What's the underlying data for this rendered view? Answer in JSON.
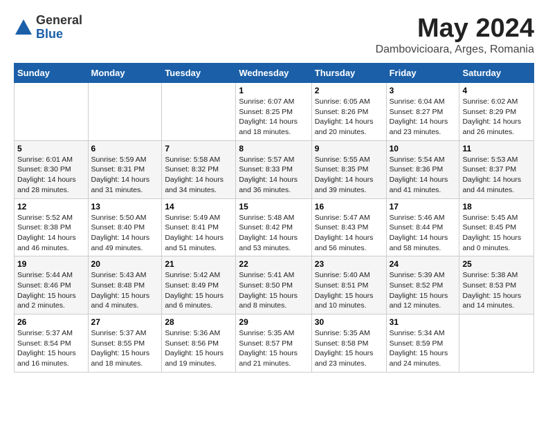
{
  "header": {
    "logo_general": "General",
    "logo_blue": "Blue",
    "month_title": "May 2024",
    "location": "Dambovicioara, Arges, Romania"
  },
  "calendar": {
    "days_of_week": [
      "Sunday",
      "Monday",
      "Tuesday",
      "Wednesday",
      "Thursday",
      "Friday",
      "Saturday"
    ],
    "weeks": [
      [
        {
          "day": "",
          "content": ""
        },
        {
          "day": "",
          "content": ""
        },
        {
          "day": "",
          "content": ""
        },
        {
          "day": "1",
          "content": "Sunrise: 6:07 AM\nSunset: 8:25 PM\nDaylight: 14 hours and 18 minutes."
        },
        {
          "day": "2",
          "content": "Sunrise: 6:05 AM\nSunset: 8:26 PM\nDaylight: 14 hours and 20 minutes."
        },
        {
          "day": "3",
          "content": "Sunrise: 6:04 AM\nSunset: 8:27 PM\nDaylight: 14 hours and 23 minutes."
        },
        {
          "day": "4",
          "content": "Sunrise: 6:02 AM\nSunset: 8:29 PM\nDaylight: 14 hours and 26 minutes."
        }
      ],
      [
        {
          "day": "5",
          "content": "Sunrise: 6:01 AM\nSunset: 8:30 PM\nDaylight: 14 hours and 28 minutes."
        },
        {
          "day": "6",
          "content": "Sunrise: 5:59 AM\nSunset: 8:31 PM\nDaylight: 14 hours and 31 minutes."
        },
        {
          "day": "7",
          "content": "Sunrise: 5:58 AM\nSunset: 8:32 PM\nDaylight: 14 hours and 34 minutes."
        },
        {
          "day": "8",
          "content": "Sunrise: 5:57 AM\nSunset: 8:33 PM\nDaylight: 14 hours and 36 minutes."
        },
        {
          "day": "9",
          "content": "Sunrise: 5:55 AM\nSunset: 8:35 PM\nDaylight: 14 hours and 39 minutes."
        },
        {
          "day": "10",
          "content": "Sunrise: 5:54 AM\nSunset: 8:36 PM\nDaylight: 14 hours and 41 minutes."
        },
        {
          "day": "11",
          "content": "Sunrise: 5:53 AM\nSunset: 8:37 PM\nDaylight: 14 hours and 44 minutes."
        }
      ],
      [
        {
          "day": "12",
          "content": "Sunrise: 5:52 AM\nSunset: 8:38 PM\nDaylight: 14 hours and 46 minutes."
        },
        {
          "day": "13",
          "content": "Sunrise: 5:50 AM\nSunset: 8:40 PM\nDaylight: 14 hours and 49 minutes."
        },
        {
          "day": "14",
          "content": "Sunrise: 5:49 AM\nSunset: 8:41 PM\nDaylight: 14 hours and 51 minutes."
        },
        {
          "day": "15",
          "content": "Sunrise: 5:48 AM\nSunset: 8:42 PM\nDaylight: 14 hours and 53 minutes."
        },
        {
          "day": "16",
          "content": "Sunrise: 5:47 AM\nSunset: 8:43 PM\nDaylight: 14 hours and 56 minutes."
        },
        {
          "day": "17",
          "content": "Sunrise: 5:46 AM\nSunset: 8:44 PM\nDaylight: 14 hours and 58 minutes."
        },
        {
          "day": "18",
          "content": "Sunrise: 5:45 AM\nSunset: 8:45 PM\nDaylight: 15 hours and 0 minutes."
        }
      ],
      [
        {
          "day": "19",
          "content": "Sunrise: 5:44 AM\nSunset: 8:46 PM\nDaylight: 15 hours and 2 minutes."
        },
        {
          "day": "20",
          "content": "Sunrise: 5:43 AM\nSunset: 8:48 PM\nDaylight: 15 hours and 4 minutes."
        },
        {
          "day": "21",
          "content": "Sunrise: 5:42 AM\nSunset: 8:49 PM\nDaylight: 15 hours and 6 minutes."
        },
        {
          "day": "22",
          "content": "Sunrise: 5:41 AM\nSunset: 8:50 PM\nDaylight: 15 hours and 8 minutes."
        },
        {
          "day": "23",
          "content": "Sunrise: 5:40 AM\nSunset: 8:51 PM\nDaylight: 15 hours and 10 minutes."
        },
        {
          "day": "24",
          "content": "Sunrise: 5:39 AM\nSunset: 8:52 PM\nDaylight: 15 hours and 12 minutes."
        },
        {
          "day": "25",
          "content": "Sunrise: 5:38 AM\nSunset: 8:53 PM\nDaylight: 15 hours and 14 minutes."
        }
      ],
      [
        {
          "day": "26",
          "content": "Sunrise: 5:37 AM\nSunset: 8:54 PM\nDaylight: 15 hours and 16 minutes."
        },
        {
          "day": "27",
          "content": "Sunrise: 5:37 AM\nSunset: 8:55 PM\nDaylight: 15 hours and 18 minutes."
        },
        {
          "day": "28",
          "content": "Sunrise: 5:36 AM\nSunset: 8:56 PM\nDaylight: 15 hours and 19 minutes."
        },
        {
          "day": "29",
          "content": "Sunrise: 5:35 AM\nSunset: 8:57 PM\nDaylight: 15 hours and 21 minutes."
        },
        {
          "day": "30",
          "content": "Sunrise: 5:35 AM\nSunset: 8:58 PM\nDaylight: 15 hours and 23 minutes."
        },
        {
          "day": "31",
          "content": "Sunrise: 5:34 AM\nSunset: 8:59 PM\nDaylight: 15 hours and 24 minutes."
        },
        {
          "day": "",
          "content": ""
        }
      ]
    ]
  }
}
